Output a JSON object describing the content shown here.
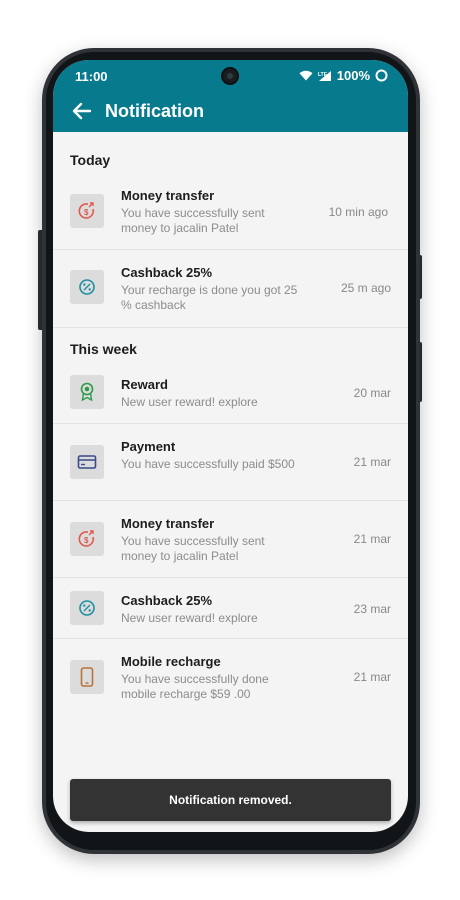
{
  "status_bar": {
    "time": "11:00",
    "battery": "100%"
  },
  "app_bar": {
    "title": "Notification"
  },
  "sections": {
    "today": "Today",
    "this_week": "This week"
  },
  "notifications": [
    {
      "title": "Money transfer",
      "desc": "You have successfully sent money to jacalin Patel",
      "time": "10 min ago",
      "icon": "money-transfer-icon"
    },
    {
      "title": "Cashback 25%",
      "desc": "Your recharge is done you got 25 % cashback",
      "time": "25 m ago",
      "icon": "cashback-icon"
    },
    {
      "title": "Reward",
      "desc": "New user reward! explore",
      "time": "20 mar",
      "icon": "reward-icon"
    },
    {
      "title": "Payment",
      "desc": "You have successfully paid $500",
      "time": "21 mar",
      "icon": "card-icon"
    },
    {
      "title": "Money transfer",
      "desc": "You have successfully sent money to jacalin Patel",
      "time": "21 mar",
      "icon": "money-transfer-icon"
    },
    {
      "title": "Cashback 25%",
      "desc": "New user reward! explore",
      "time": "23 mar",
      "icon": "cashback-icon"
    },
    {
      "title": "Mobile recharge",
      "desc": "You have successfully done mobile recharge $59 .00",
      "time": "21 mar",
      "icon": "mobile-icon"
    }
  ],
  "snackbar": {
    "message": "Notification removed."
  },
  "colors": {
    "primary": "#087a8d",
    "money_transfer": "#e05a4f",
    "cashback": "#1f8fa3",
    "reward": "#2e9a48",
    "payment": "#3a4a8c",
    "mobile": "#b8733a"
  }
}
